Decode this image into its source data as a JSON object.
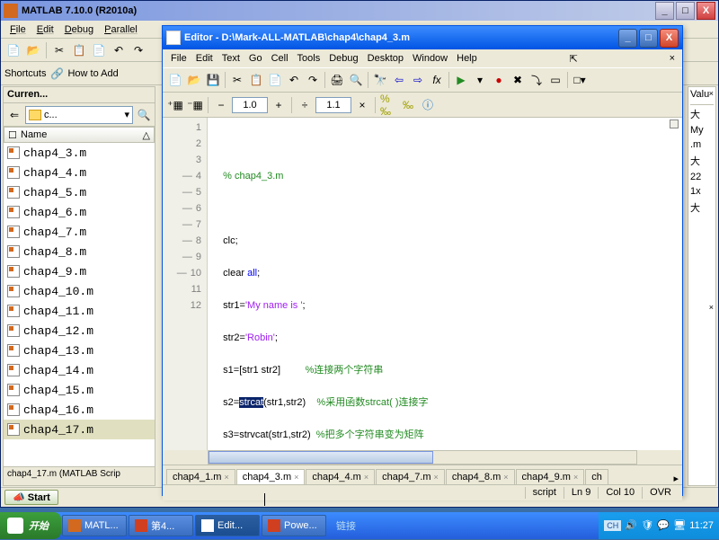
{
  "matlab": {
    "title": "MATLAB  7.10.0 (R2010a)",
    "menu": [
      "File",
      "Edit",
      "Debug",
      "Parallel"
    ],
    "toolbar2": {
      "shortcuts": "Shortcuts",
      "howtoadd": "How to Add"
    },
    "curren": {
      "title": "Curren...",
      "folder": "c...",
      "col": "Name",
      "files": [
        "chap4_3.m",
        "chap4_4.m",
        "chap4_5.m",
        "chap4_6.m",
        "chap4_7.m",
        "chap4_8.m",
        "chap4_9.m",
        "chap4_10.m",
        "chap4_11.m",
        "chap4_12.m",
        "chap4_13.m",
        "chap4_14.m",
        "chap4_15.m",
        "chap4_16.m",
        "chap4_17.m"
      ],
      "status": "chap4_17.m (MATLAB Scrip"
    },
    "start": "Start"
  },
  "editor": {
    "title": "Editor - D:\\Mark-ALL-MATLAB\\chap4\\chap4_3.m",
    "menu": [
      "File",
      "Edit",
      "Text",
      "Go",
      "Cell",
      "Tools",
      "Debug",
      "Desktop",
      "Window",
      "Help"
    ],
    "tb2": {
      "v1": "1.0",
      "v2": "1.1"
    },
    "code": {
      "l2_comment": "% chap4_3.m",
      "l4": "clc;",
      "l5a": "clear ",
      "l5b": "all",
      "l5c": ";",
      "l6a": "str1=",
      "l6b": "'My name is '",
      "l6c": ";",
      "l7a": "str2=",
      "l7b": "'Robin'",
      "l7c": ";",
      "l8a": "s1=[str1 str2]",
      "l8c": "%连接两个字符串",
      "l9a": "s2=",
      "l9h": "strcat",
      "l9b": "(str1,str2)",
      "l9c": "%采用函数strcat( )连接字",
      "l10a": "s3=strvcat(str1,str2)",
      "l10c": "%把多个字符串变为矩阵"
    },
    "tabs": [
      "chap4_1.m",
      "chap4_3.m",
      "chap4_4.m",
      "chap4_7.m",
      "chap4_8.m",
      "chap4_9.m",
      "ch"
    ],
    "status": {
      "type": "script",
      "ln_lbl": "Ln",
      "ln": "9",
      "col_lbl": "Col",
      "col": "10",
      "ovr": "OVR"
    }
  },
  "right": {
    "hdr": "Valu",
    "items": [
      "大",
      "My",
      ".m",
      "大",
      "22",
      "1x",
      "大"
    ]
  },
  "taskbar": {
    "start": "开始",
    "items": [
      "MATL...",
      "第4...",
      "Edit...",
      "Powe..."
    ],
    "link": "链接",
    "time": "11:27"
  }
}
